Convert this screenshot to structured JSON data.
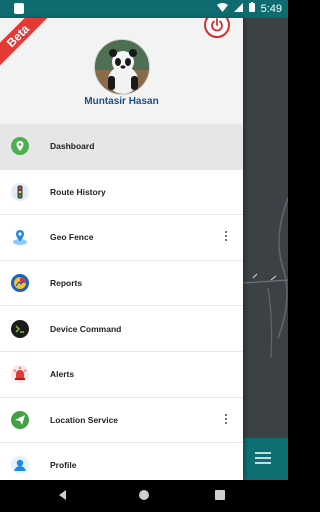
{
  "status_bar": {
    "time": "5:49"
  },
  "header": {
    "beta_label": "Beta",
    "user_name": "Muntasir Hasan"
  },
  "menu": {
    "items": [
      {
        "label": "Dashboard",
        "icon": "location-pin-icon",
        "active": true,
        "has_more": false
      },
      {
        "label": "Route History",
        "icon": "traffic-light-icon",
        "active": false,
        "has_more": false
      },
      {
        "label": "Geo Fence",
        "icon": "geo-fence-pin-icon",
        "active": false,
        "has_more": true
      },
      {
        "label": "Reports",
        "icon": "reports-icon",
        "active": false,
        "has_more": false
      },
      {
        "label": "Device Command",
        "icon": "device-command-icon",
        "active": false,
        "has_more": false
      },
      {
        "label": "Alerts",
        "icon": "alert-siren-icon",
        "active": false,
        "has_more": false
      },
      {
        "label": "Location Service",
        "icon": "send-location-icon",
        "active": false,
        "has_more": true
      },
      {
        "label": "Profile",
        "icon": "profile-icon",
        "active": false,
        "has_more": false
      }
    ]
  },
  "colors": {
    "status_bar": "#0e6b70",
    "accent": "#0d6f72",
    "beta": "#e53935",
    "power": "#d32f2f",
    "name": "#1d4f8c"
  }
}
